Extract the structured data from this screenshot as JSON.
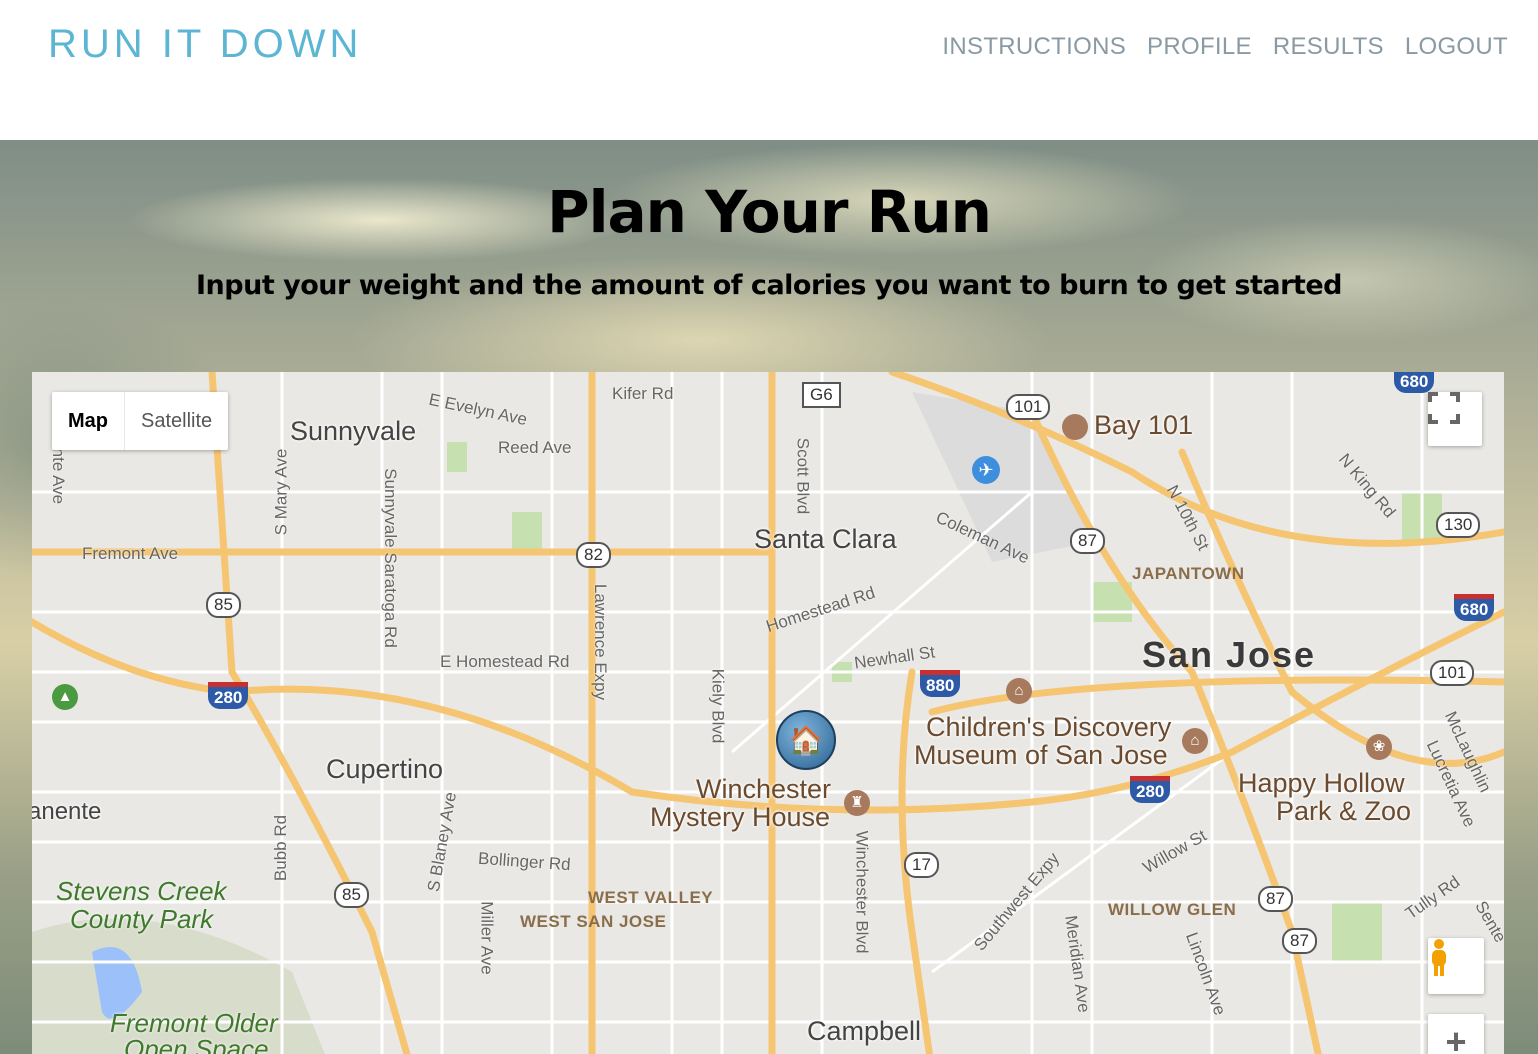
{
  "header": {
    "brand": "RUN IT DOWN",
    "nav": [
      "INSTRUCTIONS",
      "PROFILE",
      "RESULTS",
      "LOGOUT"
    ]
  },
  "hero": {
    "title": "Plan Your Run",
    "subtitle": "Input your weight and the amount of calories you want to burn to get started"
  },
  "map": {
    "map_type_map": "Map",
    "map_type_satellite": "Satellite",
    "cities": [
      "Sunnyvale",
      "Santa Clara",
      "Cupertino",
      "Campbell"
    ],
    "big_city": "San Jose",
    "streets": [
      "Kifer Rd",
      "E Evelyn Ave",
      "Reed Ave",
      "Fremont Ave",
      "S Mary Ave",
      "Sunnyvale Saratoga Rd",
      "Lawrence Expy",
      "E Homestead Rd",
      "Homestead Rd",
      "Scott Blvd",
      "Coleman Ave",
      "Newhall St",
      "Kiely Blvd",
      "N 10th St",
      "N King Rd",
      "Bubb Rd",
      "S Blaney Ave",
      "Bollinger Rd",
      "Miller Ave",
      "Winchester Blvd",
      "Southwest Expy",
      "Meridian Ave",
      "Lincoln Ave",
      "Willow St",
      "Tully Rd",
      "McLaughlin",
      "Lucretia Ave",
      "inte Ave",
      "Sente",
      "anente"
    ],
    "districts": [
      "JAPANTOWN",
      "WEST VALLEY",
      "WEST SAN JOSE",
      "WILLOW GLEN"
    ],
    "parks": [
      "Stevens Creek",
      "County Park",
      "Fremont Older",
      "Open Space"
    ],
    "pois": [
      "Bay 101",
      "Children's Discovery",
      "Museum of San Jose",
      "Winchester",
      "Mystery House",
      "Happy Hollow",
      "Park & Zoo"
    ],
    "interstates": [
      "280",
      "880",
      "280",
      "680",
      "680"
    ],
    "highways": [
      "101",
      "87",
      "130",
      "82",
      "85",
      "101",
      "17",
      "85",
      "87",
      "87",
      "G6"
    ],
    "colors": {
      "road_major": "#f5c572",
      "road_minor": "#ffffff",
      "land": "#e9e8e4",
      "park": "#c7e0b0",
      "water": "#9cc0f9"
    }
  }
}
